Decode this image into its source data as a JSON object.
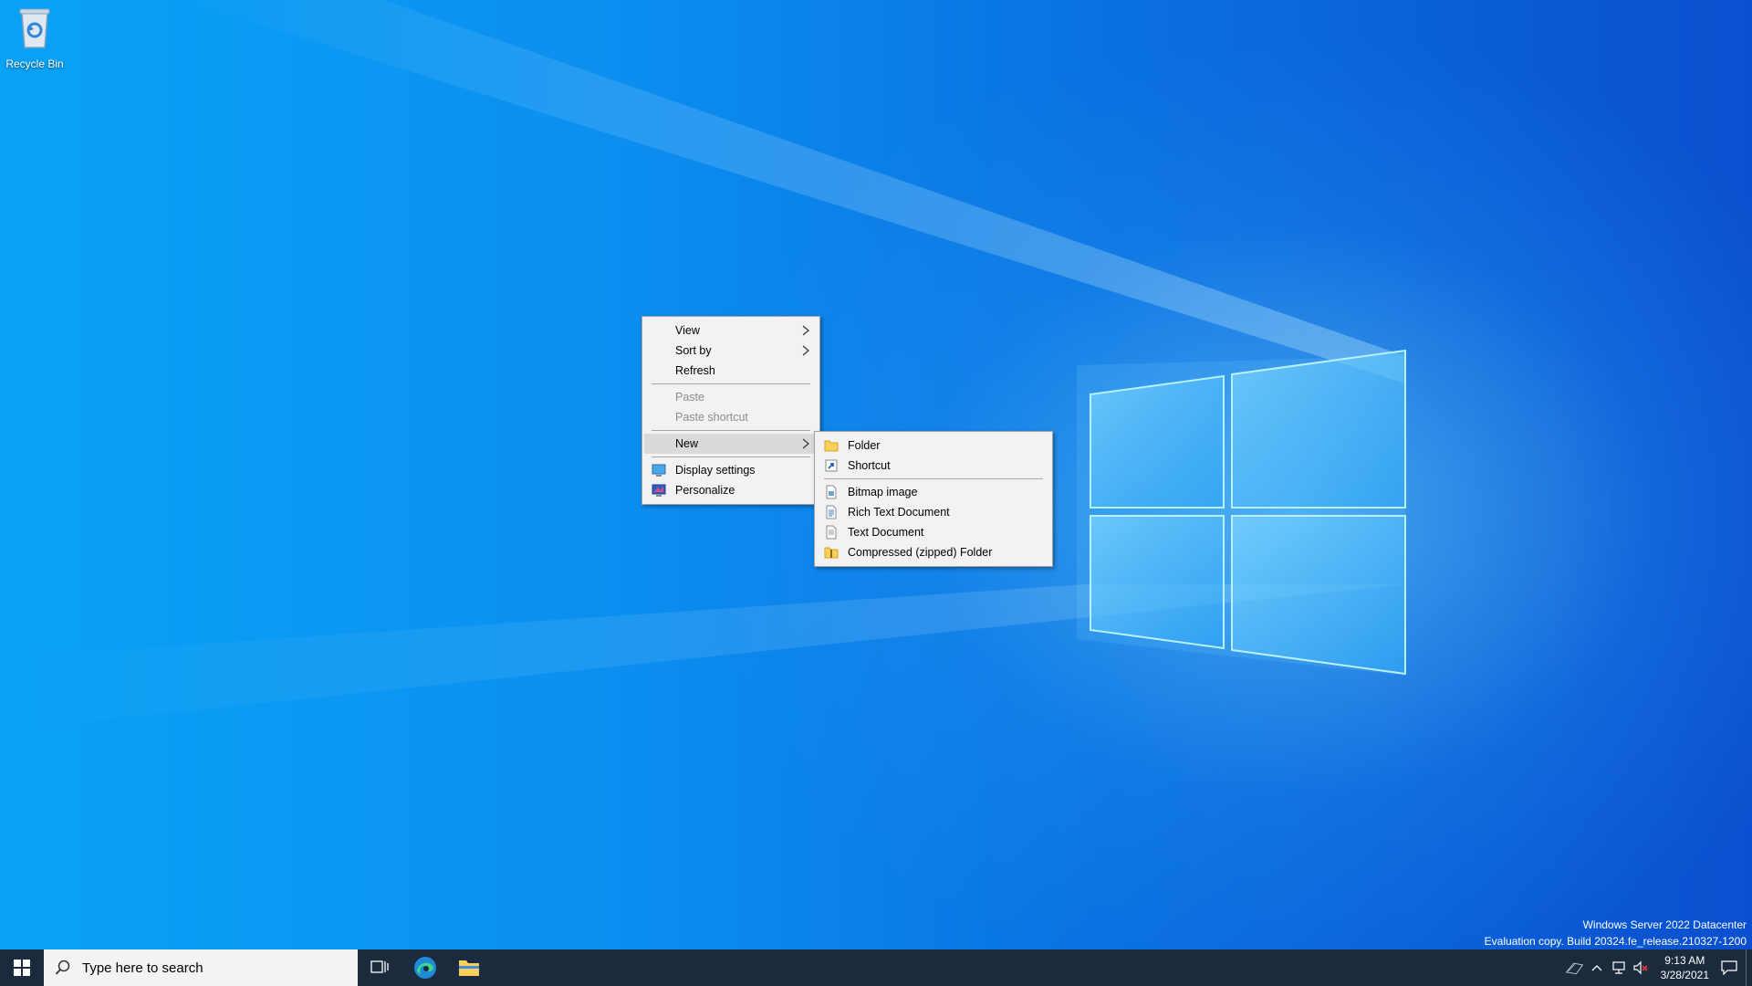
{
  "desktop": {
    "recycle_bin_label": "Recycle Bin",
    "os_edition": "Windows Server 2022 Datacenter",
    "build_info": "Evaluation copy. Build 20324.fe_release.210327-1200"
  },
  "context_menu": {
    "view": "View",
    "sort_by": "Sort by",
    "refresh": "Refresh",
    "paste": "Paste",
    "paste_shortcut": "Paste shortcut",
    "new": "New",
    "display_settings": "Display settings",
    "personalize": "Personalize"
  },
  "new_submenu": {
    "folder": "Folder",
    "shortcut": "Shortcut",
    "bitmap_image": "Bitmap image",
    "rich_text_document": "Rich Text Document",
    "text_document": "Text Document",
    "compressed_folder": "Compressed (zipped) Folder"
  },
  "taskbar": {
    "search_placeholder": "Type here to search",
    "time": "9:13 AM",
    "date": "3/28/2021"
  },
  "colors": {
    "taskbar_bg": "#1b2a3d",
    "menu_bg": "#f2f2f2",
    "menu_hover": "#dadada",
    "disabled_text": "#8d8d8d"
  }
}
